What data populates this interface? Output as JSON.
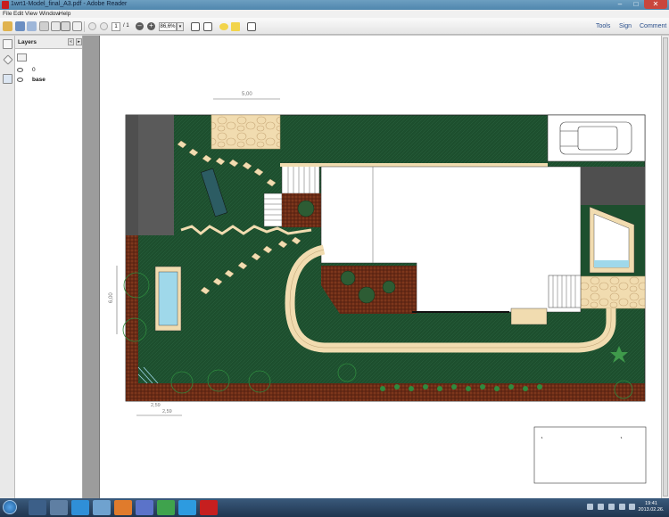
{
  "window": {
    "title": "1wrt1-Model_final_A3.pdf - Adobe Reader",
    "controls": {
      "minimize": "–",
      "maximize": "□",
      "close": "✕"
    }
  },
  "menu": [
    "File",
    "Edit",
    "View",
    "Window",
    "Help"
  ],
  "toolbar": {
    "page_current": "1",
    "page_total": "/ 1",
    "zoom_value": "86,6%",
    "zoom_out_label": "–",
    "zoom_in_label": "+",
    "dropdown_glyph": "▾",
    "tools_label": "Tools",
    "sign_label": "Sign",
    "comment_label": "Comment"
  },
  "layers_panel": {
    "title": "Layers",
    "collapse_glyph": "«",
    "options_glyph": "▸",
    "items": [
      "0",
      "base"
    ]
  },
  "drawing": {
    "dimension_top": "5,00",
    "dimension_left": "6,00",
    "dimension_bottom_a": "2,59",
    "dimension_bottom_b": "2,59",
    "colors": {
      "lawn": "#1d4f2e",
      "lawn_light": "#25603a",
      "paving": "#f1dcb0",
      "soil": "#6a2b16",
      "pool": "#9fd8ea",
      "gravel": "#4f4f4f"
    }
  },
  "taskbar": {
    "clock_time": "19:41",
    "clock_date": "2013.02.26."
  }
}
